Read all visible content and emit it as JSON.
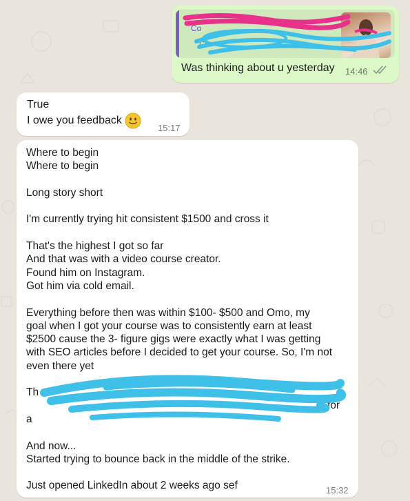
{
  "outgoing": {
    "quote_name": "Co",
    "quote_text": "Co",
    "text": "Was thinking about u yesterday",
    "time": "14:46"
  },
  "incoming_1": {
    "line1": "True",
    "line2": "I owe you feedback",
    "time": "15:17"
  },
  "incoming_2": {
    "lines": [
      "Where to begin",
      "Where to begin",
      "",
      "Long story short",
      "",
      "I'm currently trying hit consistent $1500 and cross it",
      "",
      "That's the highest I got so far",
      "And that was with a video course creator.",
      "Found him on Instagram.",
      "Got him via cold email.",
      "",
      "Everything before then was within $100- $500 and Omo, my",
      "goal when I got your course was to consistently earn at least",
      "$2500 cause the 3- figure gigs were exactly what I was getting",
      "with SEO articles before I decided to get your course. So, I'm not",
      "even there yet",
      "",
      "Th",
      "",
      "a",
      "",
      "And now...",
      "Started trying to bounce back in the middle of the strike.",
      "",
      "Just opened LinkedIn about 2 weeks ago sef"
    ],
    "visible_fragment": "for",
    "time": "15:32"
  },
  "icons": [
    "double-check-icon",
    "smiling-emoji-icon"
  ],
  "colors": {
    "outgoing_bubble": "#dbf8c6",
    "incoming_bubble": "#ffffff",
    "background": "#e9e5dd",
    "redaction_blue": "#3fc0e8",
    "redaction_pink": "#e8318a"
  }
}
